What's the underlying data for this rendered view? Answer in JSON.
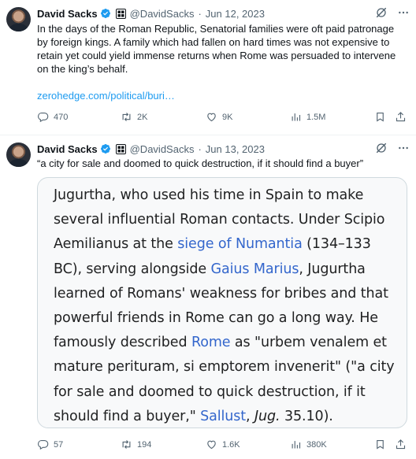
{
  "tweets": [
    {
      "author_name": "David Sacks",
      "handle": "@DavidSacks",
      "date": "Jun 12, 2023",
      "text": "In the days of the Roman Republic, Senatorial families were oft paid patronage by foreign kings. A family which had fallen on hard times was not expensive to retain yet could yield immense returns when Rome was persuaded to intervene on the king’s behalf.",
      "link": "zerohedge.com/political/buri…",
      "stats": {
        "replies": "470",
        "retweets": "2K",
        "likes": "9K",
        "views": "1.5M"
      }
    },
    {
      "author_name": "David Sacks",
      "handle": "@DavidSacks",
      "date": "Jun 13, 2023",
      "text": "“a city for sale and doomed to quick destruction, if it should find a buyer”",
      "stats": {
        "replies": "57",
        "retweets": "194",
        "likes": "1.6K",
        "views": "380K"
      }
    }
  ],
  "card": {
    "p1": "Jugurtha, who used his time in Spain to make several influential Roman contacts. Under Scipio Aemilianus at the ",
    "link1": "siege of Numantia",
    "p2": " (134–133 BC), serving alongside ",
    "link2": "Gaius Marius",
    "p3": ", Jugurtha learned of Romans' weakness for bribes and that powerful friends in Rome can go a long way. He famously described ",
    "link3": "Rome",
    "p4": " as \"urbem venalem et mature perituram, si emptorem invenerit\" (\"a city for sale and doomed to quick destruction, if it should find a buyer,\" ",
    "link4": "Sallust",
    "p5": ", ",
    "italic": "Jug.",
    "p6": " 35.10)."
  },
  "icons": [
    "verified-badge-icon",
    "affiliate-flag-icon",
    "grok-icon",
    "more-icon",
    "reply-icon",
    "retweet-icon",
    "like-icon",
    "views-icon",
    "bookmark-icon",
    "share-icon"
  ],
  "colors": {
    "link": "#1d9bf0",
    "secondary_text": "#536471",
    "verified": "#1d9bf0",
    "wiki_link": "#3366cc"
  }
}
